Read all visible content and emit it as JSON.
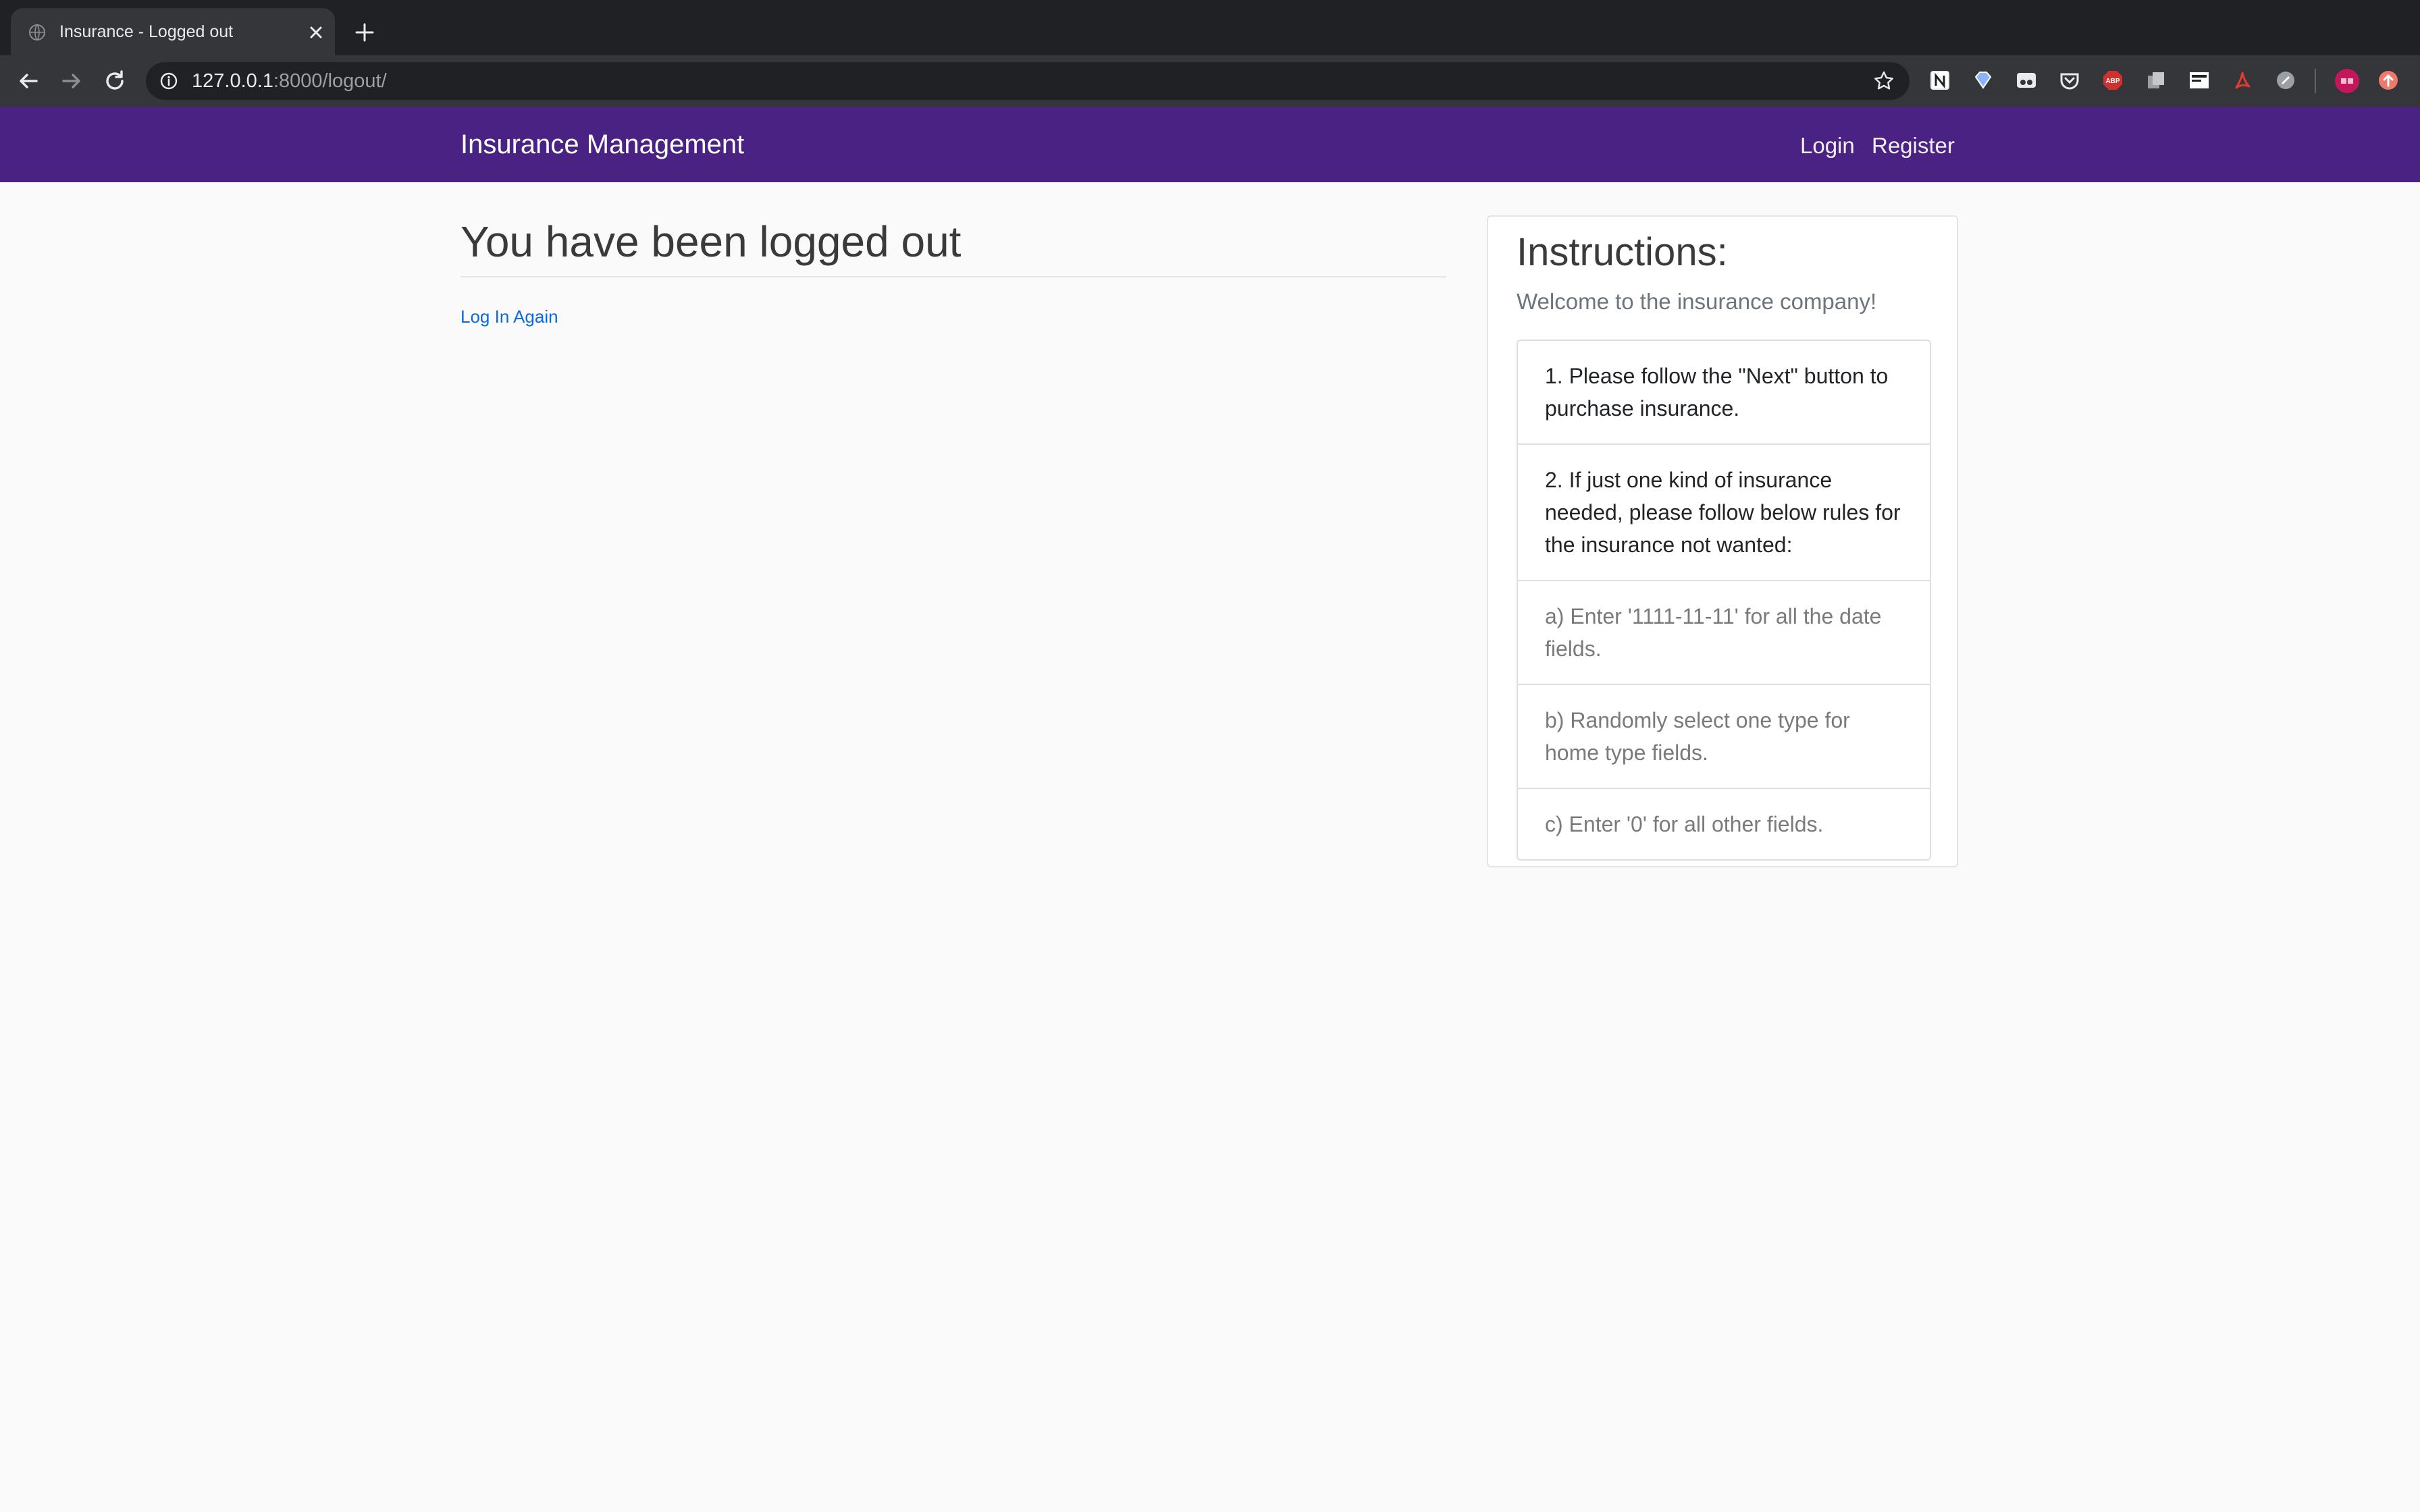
{
  "browser": {
    "tab_title": "Insurance - Logged out",
    "url_host": "127.0.0.1",
    "url_path": ":8000/logout/"
  },
  "navbar": {
    "brand": "Insurance Management",
    "login": "Login",
    "register": "Register",
    "color": "#4a2283"
  },
  "main": {
    "title": "You have been logged out",
    "link": "Log In Again"
  },
  "instructions": {
    "title": "Instructions:",
    "subtitle": "Welcome to the insurance company!",
    "items": [
      "1. Please follow the \"Next\" button to purchase insurance.",
      "2. If just one kind of insurance needed, please follow below rules for the insurance not wanted:",
      "a) Enter '1111-11-11' for all the date fields.",
      "b) Randomly select one type for home type fields.",
      "c) Enter '0' for all other fields."
    ]
  },
  "extensions": [
    "notion-icon",
    "diamond-icon",
    "reader-icon",
    "pocket-icon",
    "adblock-icon",
    "copy-icon",
    "fonts-icon",
    "acrobat-icon",
    "edit-icon",
    "profile-avatar",
    "update-icon"
  ]
}
